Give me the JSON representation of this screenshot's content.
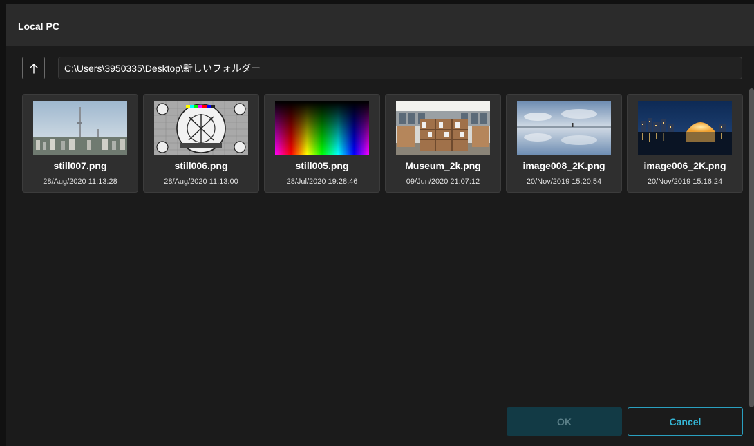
{
  "dialog": {
    "title": "Local PC"
  },
  "toolbar": {
    "up_icon": "arrow-up-icon",
    "path": "C:\\Users\\3950335\\Desktop\\新しいフォルダー"
  },
  "files": [
    {
      "name": "still007.png",
      "date": "28/Aug/2020 11:13:28",
      "thumbnail": "city-skyline-tower"
    },
    {
      "name": "still006.png",
      "date": "28/Aug/2020 11:13:00",
      "thumbnail": "test-pattern"
    },
    {
      "name": "still005.png",
      "date": "28/Jul/2020 19:28:46",
      "thumbnail": "color-gradient"
    },
    {
      "name": "Museum_2k.png",
      "date": "09/Jun/2020 21:07:12",
      "thumbnail": "library-interior"
    },
    {
      "name": "image008_2K.png",
      "date": "20/Nov/2019 15:20:54",
      "thumbnail": "salt-flat-reflection"
    },
    {
      "name": "image006_2K.png",
      "date": "20/Nov/2019 15:16:24",
      "thumbnail": "night-waterfront"
    }
  ],
  "actions": {
    "ok_label": "OK",
    "cancel_label": "Cancel"
  },
  "colors": {
    "accent": "#2aa0c0",
    "ok_bg": "#123a45",
    "card_bg": "#2f2f2f"
  }
}
